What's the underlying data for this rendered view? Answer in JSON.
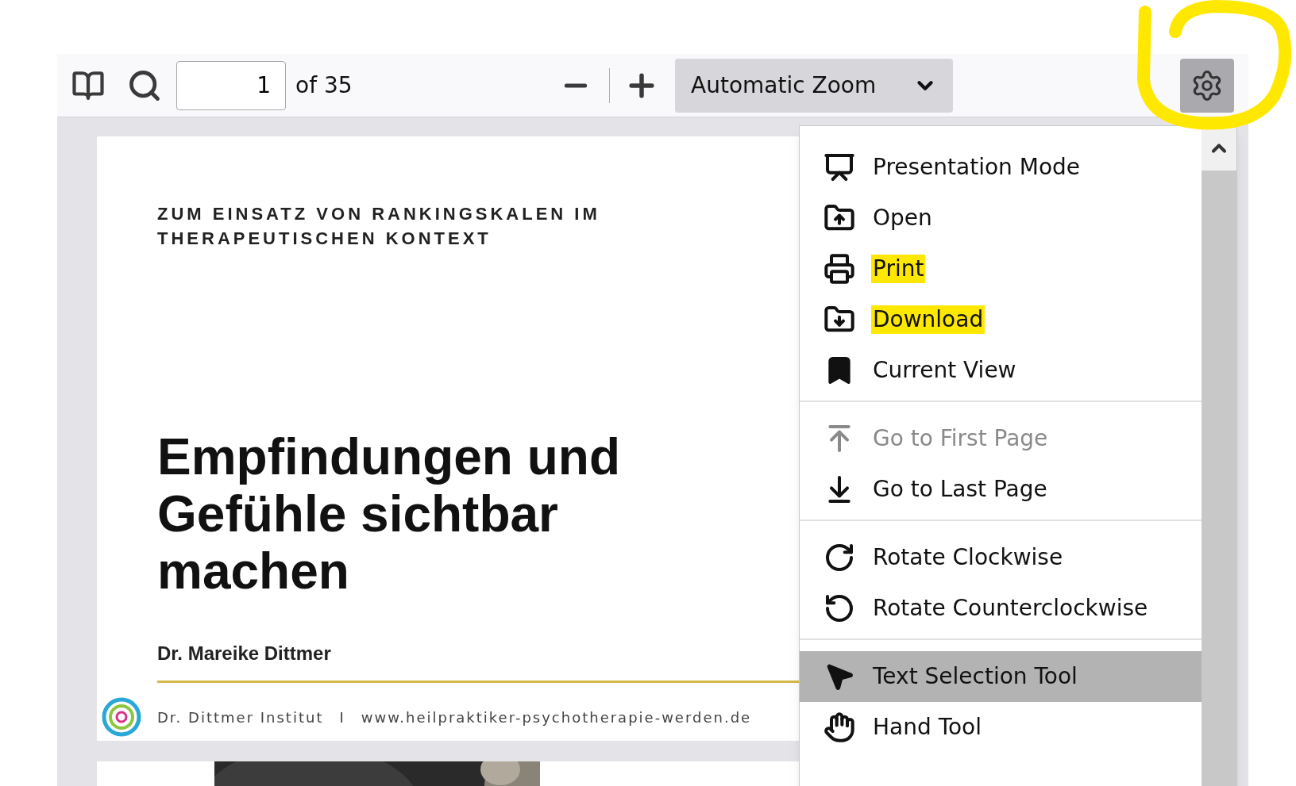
{
  "toolbar": {
    "page_number": "1",
    "page_count": "of 35",
    "zoom": "Automatic Zoom",
    "settings_pressed": true
  },
  "document": {
    "heading_lines": [
      "ZUM EINSATZ VON RANKINGSKALEN IM",
      "THERAPEUTISCHEN KONTEXT"
    ],
    "title_lines": [
      "Empfindungen und",
      "Gefühle sichtbar",
      "machen"
    ],
    "author": "Dr. Mareike Dittmer",
    "footer_institute": "Dr. Dittmer Institut",
    "footer_separator": "I",
    "footer_url": "www.heilpraktiker-psychotherapie-werden.de"
  },
  "menu": {
    "groups": [
      {
        "items": [
          {
            "label": "Presentation Mode",
            "disabled": false,
            "highlighted": false
          },
          {
            "label": "Open",
            "disabled": false,
            "highlighted": false
          },
          {
            "label": "Print",
            "disabled": false,
            "highlighted": true
          },
          {
            "label": "Download",
            "disabled": false,
            "highlighted": true
          },
          {
            "label": "Current View",
            "disabled": false,
            "highlighted": false
          }
        ]
      },
      {
        "items": [
          {
            "label": "Go to First Page",
            "disabled": true,
            "highlighted": false
          },
          {
            "label": "Go to Last Page",
            "disabled": false,
            "highlighted": false
          }
        ]
      },
      {
        "items": [
          {
            "label": "Rotate Clockwise",
            "disabled": false,
            "highlighted": false
          },
          {
            "label": "Rotate Counterclockwise",
            "disabled": false,
            "highlighted": false
          }
        ]
      },
      {
        "items": [
          {
            "label": "Text Selection Tool",
            "disabled": false,
            "highlighted": false,
            "selected": true
          },
          {
            "label": "Hand Tool",
            "disabled": false,
            "highlighted": false,
            "selected": false
          }
        ]
      }
    ]
  }
}
